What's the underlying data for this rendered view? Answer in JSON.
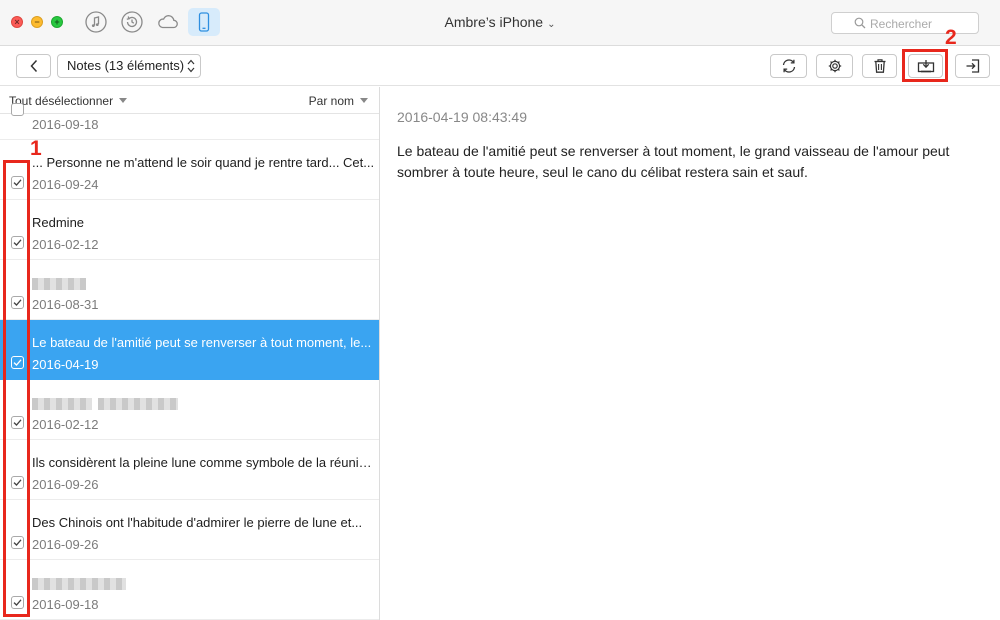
{
  "window": {
    "device_title": "Ambre’s iPhone"
  },
  "search": {
    "placeholder": "Rechercher"
  },
  "toolbar": {
    "notes_select": "Notes (13 éléments)"
  },
  "list": {
    "deselect_label": "Tout désélectionner",
    "sort_label": "Par nom",
    "items": [
      {
        "title": "",
        "date": "2016-09-18",
        "checked": false,
        "selected": false
      },
      {
        "title": "... Personne ne m'attend le soir quand je rentre tard... Cet...",
        "date": "2016-09-24",
        "checked": true,
        "selected": false
      },
      {
        "title": "Redmine",
        "date": "2016-02-12",
        "checked": true,
        "selected": false
      },
      {
        "title": "",
        "date": "2016-08-31",
        "checked": true,
        "selected": false
      },
      {
        "title": "Le bateau de l'amitié peut se renverser à tout moment, le...",
        "date": "2016-04-19",
        "checked": true,
        "selected": true
      },
      {
        "title": "",
        "date": "2016-02-12",
        "checked": true,
        "selected": false
      },
      {
        "title": "Ils considèrent la pleine lune comme symbole de la réunion ...",
        "date": "2016-09-26",
        "checked": true,
        "selected": false
      },
      {
        "title": "Des Chinois ont l'habitude d'admirer le pierre de lune et...",
        "date": "2016-09-26",
        "checked": true,
        "selected": false
      },
      {
        "title": "",
        "date": "2016-09-18",
        "checked": true,
        "selected": false
      }
    ]
  },
  "detail": {
    "timestamp": "2016-04-19 08:43:49",
    "body": "Le bateau de l'amitié peut se renverser à tout moment, le grand vaisseau de l'amour peut sombrer à toute heure, seul le cano du célibat restera sain et sauf."
  },
  "annotations": {
    "step1": "1",
    "step2": "2"
  },
  "colors": {
    "selection": "#3aa4f1",
    "annotation_red": "#e8271c",
    "active_tab_bg": "#d7ebfb"
  },
  "icons": [
    "close-icon",
    "minimize-icon",
    "maximize-icon",
    "music-icon",
    "history-icon",
    "cloud-icon",
    "phone-icon",
    "search-icon",
    "back-icon",
    "refresh-icon",
    "gear-icon",
    "trash-icon",
    "export-to-computer-icon",
    "import-icon",
    "checkmark-icon"
  ]
}
